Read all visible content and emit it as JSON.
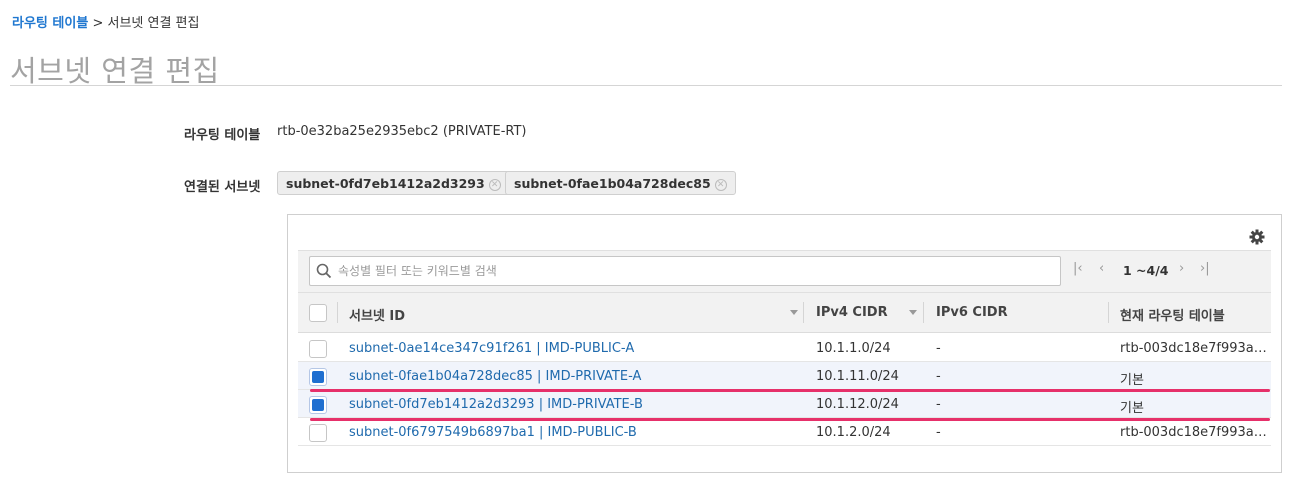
{
  "breadcrumb": {
    "parent": "라우팅 테이블",
    "separator": ">",
    "current": "서브넷 연결 편집"
  },
  "page_title": "서브넷 연결 편집",
  "route_table": {
    "label": "라우팅 테이블",
    "value": "rtb-0e32ba25e2935ebc2 (PRIVATE-RT)"
  },
  "associated": {
    "label": "연결된 서브넷",
    "tags": [
      "subnet-0fd7eb1412a2d3293",
      "subnet-0fae1b04a728dec85"
    ]
  },
  "search": {
    "placeholder": "속성별 필터 또는 키워드별 검색",
    "value": ""
  },
  "pagination": {
    "count": "1 ~4/4"
  },
  "table": {
    "columns": {
      "subnet_id": "서브넷 ID",
      "ipv4": "IPv4 CIDR",
      "ipv6": "IPv6 CIDR",
      "route_table": "현재 라우팅 테이블"
    },
    "rows": [
      {
        "subnet": "subnet-0ae14ce347c91f261 | IMD-PUBLIC-A",
        "ipv4": "10.1.1.0/24",
        "ipv6": "-",
        "route_table": "rtb-003dc18e7f993a…",
        "checked": false
      },
      {
        "subnet": "subnet-0fae1b04a728dec85 | IMD-PRIVATE-A",
        "ipv4": "10.1.11.0/24",
        "ipv6": "-",
        "route_table": "기본",
        "checked": true
      },
      {
        "subnet": "subnet-0fd7eb1412a2d3293 | IMD-PRIVATE-B",
        "ipv4": "10.1.12.0/24",
        "ipv6": "-",
        "route_table": "기본",
        "checked": true
      },
      {
        "subnet": "subnet-0f6797549b6897ba1 | IMD-PUBLIC-B",
        "ipv4": "10.1.2.0/24",
        "ipv6": "-",
        "route_table": "rtb-003dc18e7f993a…",
        "checked": false
      }
    ]
  },
  "colors": {
    "link": "#1f6aad",
    "accent": "#1f6fd0",
    "highlight": "#e6306a"
  }
}
